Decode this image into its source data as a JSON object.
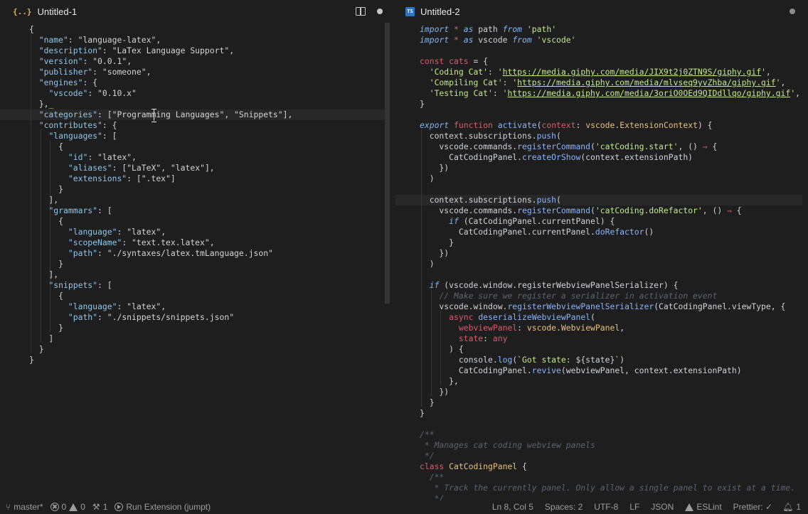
{
  "editors": [
    {
      "tab": {
        "title": "Untitled-1",
        "icon": "json-icon",
        "icon_glyph": "{..}"
      },
      "actions": [
        "split-editor",
        "unsaved-dot"
      ],
      "active_line": 8,
      "lines": [
        [
          [
            "p",
            "{"
          ]
        ],
        [
          [
            "p",
            "  "
          ],
          [
            "jk",
            "\"name\""
          ],
          [
            "p",
            ": "
          ],
          [
            "js",
            "\"language-latex\""
          ],
          [
            "p",
            ","
          ]
        ],
        [
          [
            "p",
            "  "
          ],
          [
            "jk",
            "\"description\""
          ],
          [
            "p",
            ": "
          ],
          [
            "js",
            "\"LaTex Language Support\""
          ],
          [
            "p",
            ","
          ]
        ],
        [
          [
            "p",
            "  "
          ],
          [
            "jk",
            "\"version\""
          ],
          [
            "p",
            ": "
          ],
          [
            "js",
            "\"0.0.1\""
          ],
          [
            "p",
            ","
          ]
        ],
        [
          [
            "p",
            "  "
          ],
          [
            "jk",
            "\"publisher\""
          ],
          [
            "p",
            ": "
          ],
          [
            "js",
            "\"someone\""
          ],
          [
            "p",
            ","
          ]
        ],
        [
          [
            "p",
            "  "
          ],
          [
            "jk",
            "\"engines\""
          ],
          [
            "p",
            ": {"
          ]
        ],
        [
          [
            "p",
            "    "
          ],
          [
            "jk",
            "\"vscode\""
          ],
          [
            "p",
            ": "
          ],
          [
            "js",
            "\"0.10.x\""
          ]
        ],
        [
          [
            "p",
            "  },"
          ],
          [
            "s",
            "_"
          ]
        ],
        [
          [
            "p",
            "  "
          ],
          [
            "jk",
            "\"categories\""
          ],
          [
            "p",
            ": ["
          ],
          [
            "js",
            "\"Programming Languages\""
          ],
          [
            "p",
            ", "
          ],
          [
            "js",
            "\"Snippets\""
          ],
          [
            "p",
            "],"
          ]
        ],
        [
          [
            "p",
            "  "
          ],
          [
            "jk",
            "\"contributes\""
          ],
          [
            "p",
            ": {"
          ]
        ],
        [
          [
            "p",
            "    "
          ],
          [
            "jk",
            "\"languages\""
          ],
          [
            "p",
            ": ["
          ]
        ],
        [
          [
            "p",
            "      {"
          ]
        ],
        [
          [
            "p",
            "        "
          ],
          [
            "jk",
            "\"id\""
          ],
          [
            "p",
            ": "
          ],
          [
            "js",
            "\"latex\""
          ],
          [
            "p",
            ","
          ]
        ],
        [
          [
            "p",
            "        "
          ],
          [
            "jk",
            "\"aliases\""
          ],
          [
            "p",
            ": ["
          ],
          [
            "js",
            "\"LaTeX\""
          ],
          [
            "p",
            ", "
          ],
          [
            "js",
            "\"latex\""
          ],
          [
            "p",
            "],"
          ]
        ],
        [
          [
            "p",
            "        "
          ],
          [
            "jk",
            "\"extensions\""
          ],
          [
            "p",
            ": ["
          ],
          [
            "js",
            "\".tex\""
          ],
          [
            "p",
            "]"
          ]
        ],
        [
          [
            "p",
            "      }"
          ]
        ],
        [
          [
            "p",
            "    ],"
          ]
        ],
        [
          [
            "p",
            "    "
          ],
          [
            "jk",
            "\"grammars\""
          ],
          [
            "p",
            ": ["
          ]
        ],
        [
          [
            "p",
            "      {"
          ]
        ],
        [
          [
            "p",
            "        "
          ],
          [
            "jk",
            "\"language\""
          ],
          [
            "p",
            ": "
          ],
          [
            "js",
            "\"latex\""
          ],
          [
            "p",
            ","
          ]
        ],
        [
          [
            "p",
            "        "
          ],
          [
            "jk",
            "\"scopeName\""
          ],
          [
            "p",
            ": "
          ],
          [
            "js",
            "\"text.tex.latex\""
          ],
          [
            "p",
            ","
          ]
        ],
        [
          [
            "p",
            "        "
          ],
          [
            "jk",
            "\"path\""
          ],
          [
            "p",
            ": "
          ],
          [
            "js",
            "\"./syntaxes/latex.tmLanguage.json\""
          ]
        ],
        [
          [
            "p",
            "      }"
          ]
        ],
        [
          [
            "p",
            "    ],"
          ]
        ],
        [
          [
            "p",
            "    "
          ],
          [
            "jk",
            "\"snippets\""
          ],
          [
            "p",
            ": ["
          ]
        ],
        [
          [
            "p",
            "      {"
          ]
        ],
        [
          [
            "p",
            "        "
          ],
          [
            "jk",
            "\"language\""
          ],
          [
            "p",
            ": "
          ],
          [
            "js",
            "\"latex\""
          ],
          [
            "p",
            ","
          ]
        ],
        [
          [
            "p",
            "        "
          ],
          [
            "jk",
            "\"path\""
          ],
          [
            "p",
            ": "
          ],
          [
            "js",
            "\"./snippets/snippets.json\""
          ]
        ],
        [
          [
            "p",
            "      }"
          ]
        ],
        [
          [
            "p",
            "    ]"
          ]
        ],
        [
          [
            "p",
            "  }"
          ]
        ],
        [
          [
            "p",
            "}"
          ]
        ]
      ]
    },
    {
      "tab": {
        "title": "Untitled-2",
        "icon": "typescript-icon",
        "icon_glyph": "TS"
      },
      "actions": [
        "unsaved-dot"
      ],
      "active_line": 16,
      "lines": [
        [
          [
            "k",
            "import"
          ],
          [
            "p",
            " "
          ],
          [
            "d",
            "*"
          ],
          [
            "p",
            " "
          ],
          [
            "k",
            "as"
          ],
          [
            "p",
            " path "
          ],
          [
            "k",
            "from"
          ],
          [
            "p",
            " "
          ],
          [
            "s",
            "'path'"
          ]
        ],
        [
          [
            "k",
            "import"
          ],
          [
            "p",
            " "
          ],
          [
            "d",
            "*"
          ],
          [
            "p",
            " "
          ],
          [
            "k",
            "as"
          ],
          [
            "p",
            " vscode "
          ],
          [
            "k",
            "from"
          ],
          [
            "p",
            " "
          ],
          [
            "s",
            "'vscode'"
          ]
        ],
        [],
        [
          [
            "d",
            "const"
          ],
          [
            "p",
            " "
          ],
          [
            "d",
            "cats"
          ],
          [
            "p",
            " = {"
          ]
        ],
        [
          [
            "p",
            "  "
          ],
          [
            "s",
            "'Coding Cat'"
          ],
          [
            "p",
            ": "
          ],
          [
            "s",
            "'"
          ],
          [
            "sl",
            "https://media.giphy.com/media/JIX9t2j0ZTN9S/giphy.gif"
          ],
          [
            "s",
            "'"
          ],
          [
            "p",
            ","
          ]
        ],
        [
          [
            "p",
            "  "
          ],
          [
            "s",
            "'Compiling Cat'"
          ],
          [
            "p",
            ": "
          ],
          [
            "s",
            "'"
          ],
          [
            "sl",
            "https://media.giphy.com/media/mlvseq9yvZhba/giphy.gif"
          ],
          [
            "s",
            "'"
          ],
          [
            "p",
            ","
          ]
        ],
        [
          [
            "p",
            "  "
          ],
          [
            "s",
            "'Testing Cat'"
          ],
          [
            "p",
            ": "
          ],
          [
            "s",
            "'"
          ],
          [
            "sl",
            "https://media.giphy.com/media/3oriO0OEd9QIDdllqo/giphy.gif"
          ],
          [
            "s",
            "'"
          ],
          [
            "p",
            ","
          ]
        ],
        [
          [
            "p",
            "}"
          ]
        ],
        [],
        [
          [
            "k",
            "export"
          ],
          [
            "p",
            " "
          ],
          [
            "d",
            "function"
          ],
          [
            "p",
            " "
          ],
          [
            "f",
            "activate"
          ],
          [
            "p",
            "("
          ],
          [
            "d",
            "context"
          ],
          [
            "p",
            ": "
          ],
          [
            "t",
            "vscode"
          ],
          [
            "p",
            "."
          ],
          [
            "t",
            "ExtensionContext"
          ],
          [
            "p",
            ") {"
          ]
        ],
        [
          [
            "p",
            "  context.subscriptions."
          ],
          [
            "f",
            "push"
          ],
          [
            "p",
            "("
          ]
        ],
        [
          [
            "p",
            "    vscode.commands."
          ],
          [
            "f",
            "registerCommand"
          ],
          [
            "p",
            "("
          ],
          [
            "s",
            "'catCoding.start'"
          ],
          [
            "p",
            ", () "
          ],
          [
            "d",
            "⇒"
          ],
          [
            "p",
            " {"
          ]
        ],
        [
          [
            "p",
            "      CatCodingPanel."
          ],
          [
            "f",
            "createOrShow"
          ],
          [
            "p",
            "(context.extensionPath)"
          ]
        ],
        [
          [
            "p",
            "    })"
          ]
        ],
        [
          [
            "p",
            "  )"
          ]
        ],
        [],
        [
          [
            "p",
            "  context.subscriptions."
          ],
          [
            "f",
            "push"
          ],
          [
            "p",
            "("
          ]
        ],
        [
          [
            "p",
            "    vscode.commands."
          ],
          [
            "f",
            "registerCommand"
          ],
          [
            "p",
            "("
          ],
          [
            "s",
            "'catCoding.doRefactor'"
          ],
          [
            "p",
            ", () "
          ],
          [
            "d",
            "⇒"
          ],
          [
            "p",
            " {"
          ]
        ],
        [
          [
            "p",
            "      "
          ],
          [
            "k",
            "if"
          ],
          [
            "p",
            " (CatCodingPanel.currentPanel) {"
          ]
        ],
        [
          [
            "p",
            "        CatCodingPanel.currentPanel."
          ],
          [
            "f",
            "doRefactor"
          ],
          [
            "p",
            "()"
          ]
        ],
        [
          [
            "p",
            "      }"
          ]
        ],
        [
          [
            "p",
            "    })"
          ]
        ],
        [
          [
            "p",
            "  )"
          ]
        ],
        [],
        [
          [
            "p",
            "  "
          ],
          [
            "k",
            "if"
          ],
          [
            "p",
            " (vscode.window.registerWebviewPanelSerializer) {"
          ]
        ],
        [
          [
            "p",
            "    "
          ],
          [
            "c",
            "// Make sure we register a serializer in activation event"
          ]
        ],
        [
          [
            "p",
            "    vscode.window."
          ],
          [
            "f",
            "registerWebviewPanelSerializer"
          ],
          [
            "p",
            "(CatCodingPanel.viewType, {"
          ]
        ],
        [
          [
            "p",
            "      "
          ],
          [
            "d",
            "async"
          ],
          [
            "p",
            " "
          ],
          [
            "f",
            "deserializeWebviewPanel"
          ],
          [
            "p",
            "("
          ]
        ],
        [
          [
            "p",
            "        "
          ],
          [
            "d",
            "webviewPanel"
          ],
          [
            "p",
            ": "
          ],
          [
            "t",
            "vscode"
          ],
          [
            "p",
            "."
          ],
          [
            "t",
            "WebviewPanel"
          ],
          [
            "p",
            ","
          ]
        ],
        [
          [
            "p",
            "        "
          ],
          [
            "d",
            "state"
          ],
          [
            "p",
            ": "
          ],
          [
            "d",
            "any"
          ]
        ],
        [
          [
            "p",
            "      ) {"
          ]
        ],
        [
          [
            "p",
            "        console."
          ],
          [
            "f",
            "log"
          ],
          [
            "p",
            "("
          ],
          [
            "s",
            "`Got state: "
          ],
          [
            "p",
            "${state}"
          ],
          [
            "s",
            "`"
          ],
          [
            "p",
            ")"
          ]
        ],
        [
          [
            "p",
            "        CatCodingPanel."
          ],
          [
            "f",
            "revive"
          ],
          [
            "p",
            "(webviewPanel, context.extensionPath)"
          ]
        ],
        [
          [
            "p",
            "      },"
          ]
        ],
        [
          [
            "p",
            "    })"
          ]
        ],
        [
          [
            "p",
            "  }"
          ]
        ],
        [
          [
            "p",
            "}"
          ]
        ],
        [],
        [
          [
            "c",
            "/**"
          ]
        ],
        [
          [
            "c",
            " * Manages cat coding webview panels"
          ]
        ],
        [
          [
            "c",
            " */"
          ]
        ],
        [
          [
            "d",
            "class"
          ],
          [
            "p",
            " "
          ],
          [
            "t",
            "CatCodingPanel"
          ],
          [
            "p",
            " {"
          ]
        ],
        [
          [
            "p",
            "  "
          ],
          [
            "c",
            "/**"
          ]
        ],
        [
          [
            "p",
            "  "
          ],
          [
            "c",
            " * Track the currently panel. Only allow a single panel to exist at a time."
          ]
        ],
        [
          [
            "p",
            "  "
          ],
          [
            "c",
            " */"
          ]
        ]
      ]
    }
  ],
  "statusbar": {
    "branch": "master*",
    "errors": "0",
    "warnings": "0",
    "tools": "1",
    "run_label": "Run Extension (jumpt)",
    "position": "Ln 8, Col 5",
    "spaces": "Spaces: 2",
    "encoding": "UTF-8",
    "eol": "LF",
    "language": "JSON",
    "eslint": "ESLint",
    "prettier": "Prettier: ✓",
    "notifications": "1"
  },
  "colors": {
    "background": "#1e1e1e",
    "keyword": "#7cb7f0",
    "declaration": "#d85c6c",
    "string": "#c3e88d",
    "function": "#89b4fa",
    "type": "#e5c07b",
    "comment": "#5c6370"
  }
}
